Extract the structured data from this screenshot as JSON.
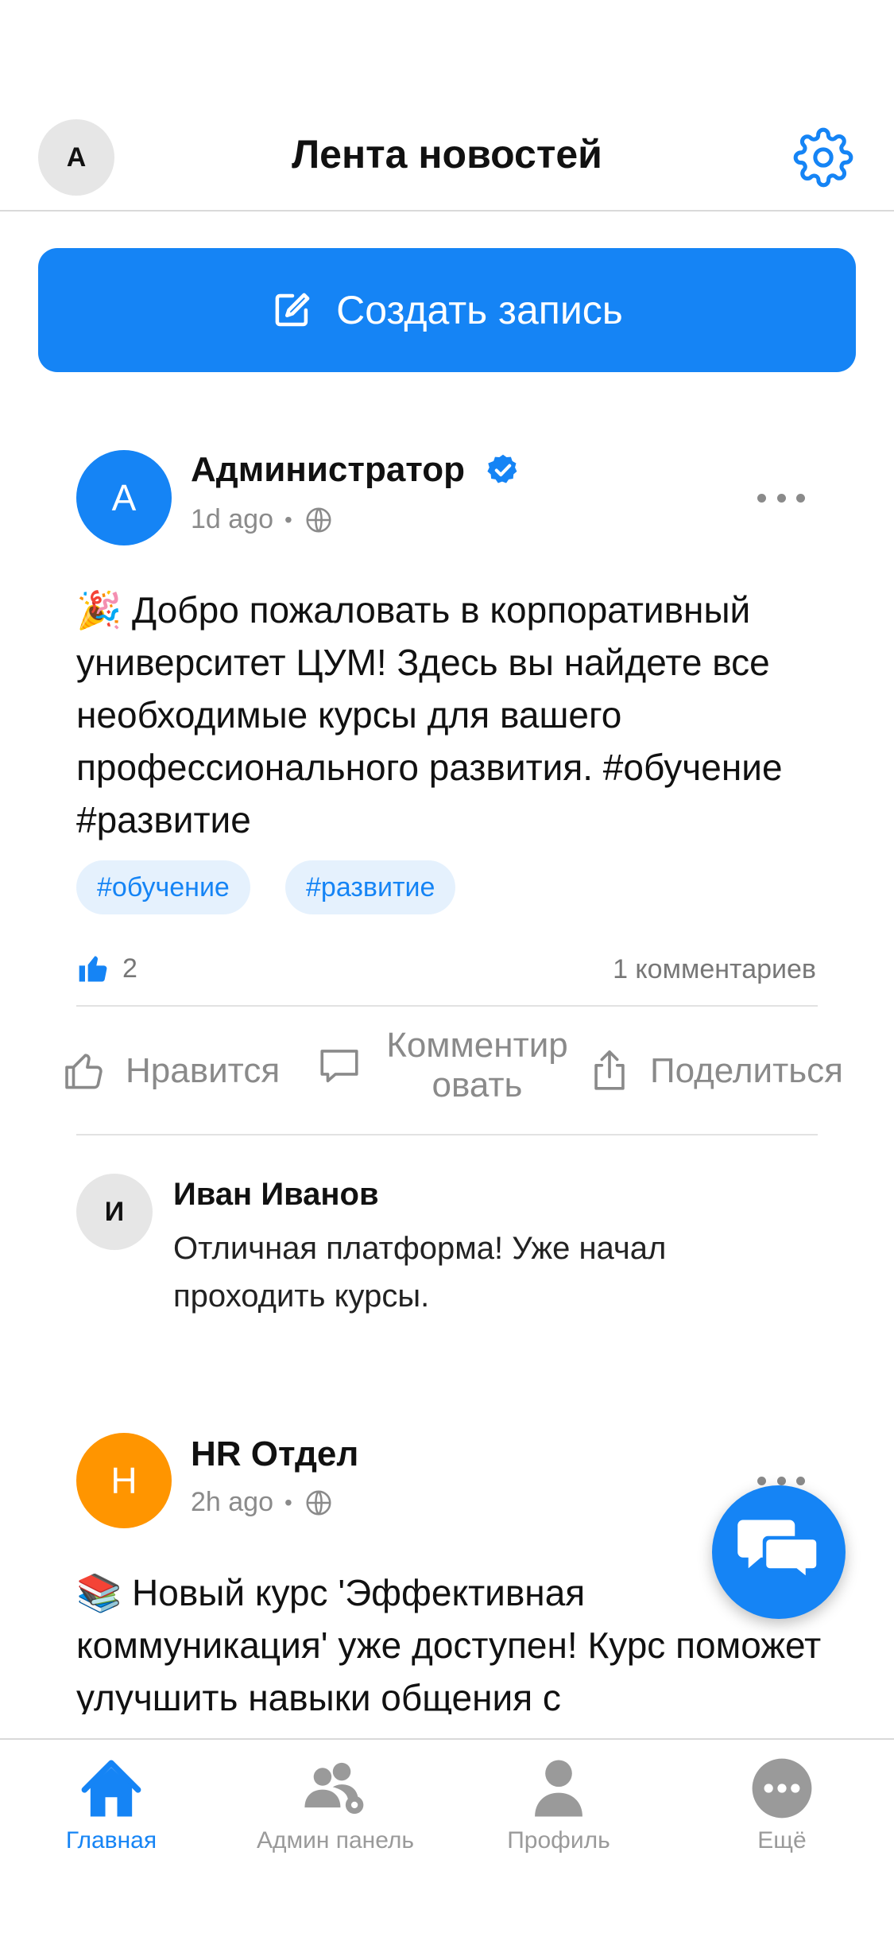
{
  "header": {
    "avatar_letter": "А",
    "title": "Лента новостей"
  },
  "create_post": {
    "label": "Создать запись"
  },
  "posts": [
    {
      "avatar_letter": "А",
      "author": "Администратор",
      "verified": true,
      "time": "1d ago",
      "text": "🎉 Добро пожаловать в корпоративный университет ЦУМ! Здесь вы найдете все необходимые курсы для вашего профессионального развития. #обучение #развитие",
      "tags": [
        "#обучение",
        "#развитие"
      ],
      "likes": "2",
      "comments_count": "1 комментариев",
      "actions": {
        "like": "Нравится",
        "comment": "Комментировать",
        "share": "Поделиться"
      },
      "comment": {
        "avatar_letter": "И",
        "author": "Иван Иванов",
        "text": "Отличная платформа! Уже начал проходить курсы."
      }
    },
    {
      "avatar_letter": "H",
      "author": "HR Отдел",
      "time": "2h ago",
      "text": "📚 Новый курс 'Эффективная коммуникация' уже доступен! Курс поможет улучшить навыки общения с"
    }
  ],
  "tabbar": {
    "home": "Главная",
    "admin": "Админ панель",
    "profile": "Профиль",
    "more": "Ещё"
  },
  "colors": {
    "accent": "#1584f5",
    "hr_avatar": "#ff9500"
  }
}
